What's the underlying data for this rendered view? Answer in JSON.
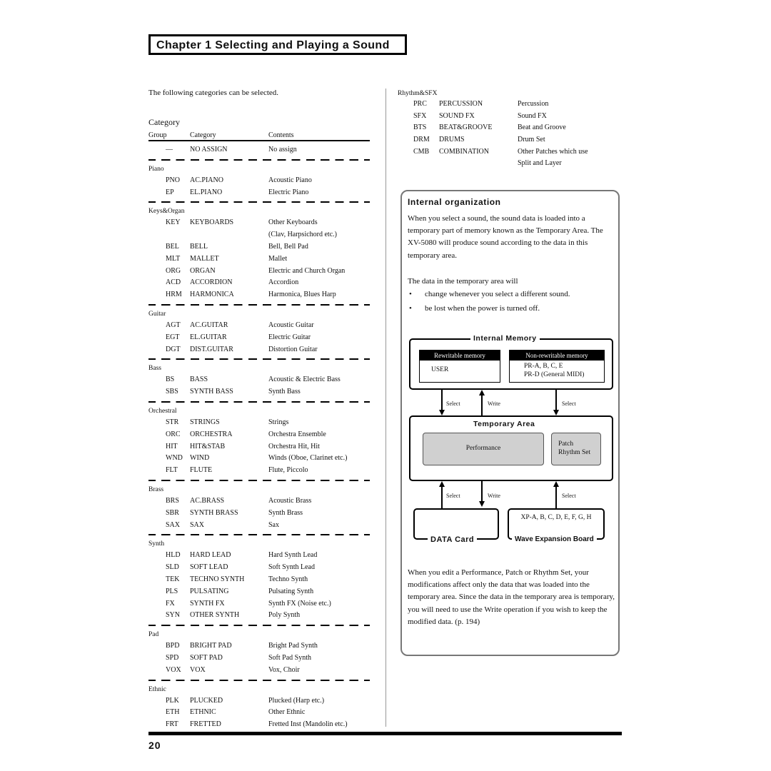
{
  "header": {
    "chapter_title": "Chapter 1 Selecting and Playing a Sound"
  },
  "intro": "The following categories can be selected.",
  "category_table": {
    "caption": "Category",
    "columns": [
      "Group",
      "Category",
      "Contents"
    ],
    "no_assign": {
      "group": "—",
      "category": "NO ASSIGN",
      "contents": "No assign"
    },
    "groups": [
      {
        "name": "Piano",
        "rows": [
          {
            "code": "PNO",
            "category": "AC.PIANO",
            "contents": "Acoustic Piano"
          },
          {
            "code": "EP",
            "category": "EL.PIANO",
            "contents": "Electric Piano"
          }
        ]
      },
      {
        "name": "Keys&Organ",
        "rows": [
          {
            "code": "KEY",
            "category": "KEYBOARDS",
            "contents": "Other Keyboards"
          },
          {
            "code": "",
            "category": "",
            "contents": "(Clav, Harpsichord etc.)"
          },
          {
            "code": "BEL",
            "category": "BELL",
            "contents": "Bell, Bell Pad"
          },
          {
            "code": "MLT",
            "category": "MALLET",
            "contents": "Mallet"
          },
          {
            "code": "ORG",
            "category": "ORGAN",
            "contents": "Electric and Church Organ"
          },
          {
            "code": "ACD",
            "category": "ACCORDION",
            "contents": "Accordion"
          },
          {
            "code": "HRM",
            "category": "HARMONICA",
            "contents": "Harmonica, Blues Harp"
          }
        ]
      },
      {
        "name": "Guitar",
        "rows": [
          {
            "code": "AGT",
            "category": "AC.GUITAR",
            "contents": "Acoustic Guitar"
          },
          {
            "code": "EGT",
            "category": "EL.GUITAR",
            "contents": "Electric Guitar"
          },
          {
            "code": "DGT",
            "category": "DIST.GUITAR",
            "contents": "Distortion Guitar"
          }
        ]
      },
      {
        "name": "Bass",
        "rows": [
          {
            "code": "BS",
            "category": "BASS",
            "contents": "Acoustic & Electric Bass"
          },
          {
            "code": "SBS",
            "category": "SYNTH BASS",
            "contents": "Synth Bass"
          }
        ]
      },
      {
        "name": "Orchestral",
        "rows": [
          {
            "code": "STR",
            "category": "STRINGS",
            "contents": "Strings"
          },
          {
            "code": "ORC",
            "category": "ORCHESTRA",
            "contents": "Orchestra Ensemble"
          },
          {
            "code": "HIT",
            "category": "HIT&STAB",
            "contents": "Orchestra Hit, Hit"
          },
          {
            "code": "WND",
            "category": "WIND",
            "contents": "Winds (Oboe, Clarinet etc.)"
          },
          {
            "code": "FLT",
            "category": "FLUTE",
            "contents": "Flute, Piccolo"
          }
        ]
      },
      {
        "name": "Brass",
        "rows": [
          {
            "code": "BRS",
            "category": "AC.BRASS",
            "contents": "Acoustic Brass"
          },
          {
            "code": "SBR",
            "category": "SYNTH BRASS",
            "contents": "Synth Brass"
          },
          {
            "code": "SAX",
            "category": "SAX",
            "contents": "Sax"
          }
        ]
      },
      {
        "name": "Synth",
        "rows": [
          {
            "code": "HLD",
            "category": "HARD LEAD",
            "contents": "Hard Synth Lead"
          },
          {
            "code": "SLD",
            "category": "SOFT LEAD",
            "contents": "Soft Synth Lead"
          },
          {
            "code": "TEK",
            "category": "TECHNO SYNTH",
            "contents": "Techno Synth"
          },
          {
            "code": "PLS",
            "category": "PULSATING",
            "contents": "Pulsating Synth"
          },
          {
            "code": "FX",
            "category": "SYNTH FX",
            "contents": "Synth FX (Noise etc.)"
          },
          {
            "code": "SYN",
            "category": "OTHER SYNTH",
            "contents": "Poly Synth"
          }
        ]
      },
      {
        "name": "Pad",
        "rows": [
          {
            "code": "BPD",
            "category": "BRIGHT PAD",
            "contents": "Bright Pad Synth"
          },
          {
            "code": "SPD",
            "category": "SOFT PAD",
            "contents": "Soft Pad Synth"
          },
          {
            "code": "VOX",
            "category": "VOX",
            "contents": "Vox, Choir"
          }
        ]
      },
      {
        "name": "Ethnic",
        "rows": [
          {
            "code": "PLK",
            "category": "PLUCKED",
            "contents": "Plucked (Harp etc.)"
          },
          {
            "code": "ETH",
            "category": "ETHNIC",
            "contents": "Other Ethnic"
          },
          {
            "code": "FRT",
            "category": "FRETTED",
            "contents": "Fretted Inst (Mandolin etc.)"
          }
        ]
      }
    ],
    "continued_group": {
      "name": "Rhythm&SFX",
      "rows": [
        {
          "code": "PRC",
          "category": "PERCUSSION",
          "contents": "Percussion"
        },
        {
          "code": "SFX",
          "category": "SOUND FX",
          "contents": "Sound FX"
        },
        {
          "code": "BTS",
          "category": "BEAT&GROOVE",
          "contents": "Beat and Groove"
        },
        {
          "code": "DRM",
          "category": "DRUMS",
          "contents": "Drum Set"
        },
        {
          "code": "CMB",
          "category": "COMBINATION",
          "contents": "Other Patches which use"
        },
        {
          "code": "",
          "category": "",
          "contents": "Split and Layer"
        }
      ]
    }
  },
  "internal_org": {
    "title": "Internal organization",
    "para1": "When you select a sound, the sound data is loaded into a temporary part of memory known as the Temporary Area. The XV-5080 will produce sound according to the data in this temporary area.",
    "para2": "The data in the temporary area will",
    "bullets": [
      "change whenever you select a different sound.",
      "be lost when the power is turned off."
    ],
    "para3": "When you edit a Performance, Patch or Rhythm Set, your modifications affect only the data that was loaded into the temporary area. Since the data in the temporary area is temporary, you will need to use the Write operation if you wish to keep the modified data. (p. 194)",
    "bullet_glyph": "•"
  },
  "diagram": {
    "internal_memory": {
      "label": "Internal Memory",
      "rewritable": {
        "header": "Rewritable memory",
        "lines": [
          "USER"
        ]
      },
      "non_rewritable": {
        "header": "Non-rewritable memory",
        "lines": [
          "PR-A, B, C, E",
          "PR-D (General MIDI)"
        ]
      }
    },
    "arrows_top": {
      "select_left": "Select",
      "write": "Write",
      "select_right": "Select"
    },
    "temporary_area": {
      "label": "Temporary Area",
      "performance": "Performance",
      "patch_lines": [
        "Patch",
        "Rhythm Set"
      ]
    },
    "arrows_bottom": {
      "select_left": "Select",
      "write": "Write",
      "select_right": "Select"
    },
    "data_card": {
      "label": "DATA Card"
    },
    "wave_board": {
      "label": "Wave Expansion Board",
      "contents": "XP-A, B, C, D, E, F, G, H"
    }
  },
  "footer": {
    "page_number": "20"
  }
}
